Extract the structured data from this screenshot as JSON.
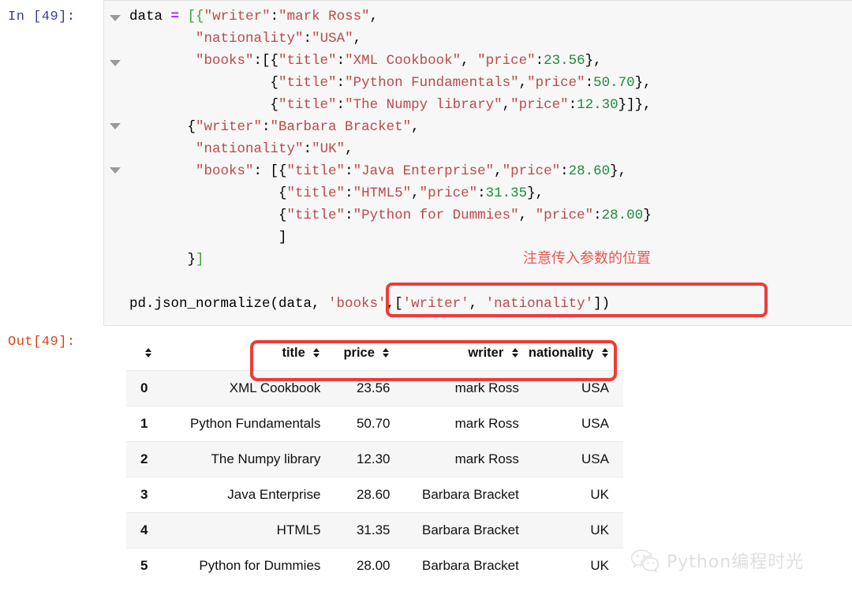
{
  "notebook": {
    "in_prompt": "In [49]:",
    "out_prompt": "Out[49]:",
    "collapse_icon": "triangle-down-icon"
  },
  "code": {
    "lines": [
      "data = [{\"writer\":\"mark Ross\",",
      "        \"nationality\":\"USA\",",
      "        \"books\":[{\"title\":\"XML Cookbook\", \"price\":23.56},",
      "                 {\"title\":\"Python Fundamentals\",\"price\":50.70},",
      "                 {\"title\":\"The Numpy library\",\"price\":12.30}]},",
      "        {\"writer\":\"Barbara Bracket\",",
      "         \"nationality\":\"UK\",",
      "         \"books\": [{\"title\":\"Java Enterprise\",\"price\":28.60},",
      "                   {\"title\":\"HTML5\",\"price\":31.35},",
      "                   {\"title\":\"Python for Dummies\", \"price\":28.00}",
      "                   ]",
      "        }]",
      "",
      "pd.json_normalize(data, 'books',['writer', 'nationality'])"
    ],
    "statement_call": "pd.json_normalize(data, 'books',['writer', 'nationality'])",
    "highlighted_arguments": "'books',['writer', 'nationality'])"
  },
  "annotation": {
    "text": "注意传入参数的位置"
  },
  "table": {
    "columns": [
      "",
      "title",
      "price",
      "writer",
      "nationality"
    ],
    "sort_icon": "sort-updown-icon",
    "rows": [
      {
        "index": "0",
        "title": "XML Cookbook",
        "price": "23.56",
        "writer": "mark Ross",
        "nationality": "USA"
      },
      {
        "index": "1",
        "title": "Python Fundamentals",
        "price": "50.70",
        "writer": "mark Ross",
        "nationality": "USA"
      },
      {
        "index": "2",
        "title": "The Numpy library",
        "price": "12.30",
        "writer": "mark Ross",
        "nationality": "USA"
      },
      {
        "index": "3",
        "title": "Java Enterprise",
        "price": "28.60",
        "writer": "Barbara Bracket",
        "nationality": "UK"
      },
      {
        "index": "4",
        "title": "HTML5",
        "price": "31.35",
        "writer": "Barbara Bracket",
        "nationality": "UK"
      },
      {
        "index": "5",
        "title": "Python for Dummies",
        "price": "28.00",
        "writer": "Barbara Bracket",
        "nationality": "UK"
      }
    ]
  },
  "watermark": {
    "text": "Python编程时光",
    "icon": "wechat-icon"
  },
  "colors": {
    "highlight_red": "#ee3b38",
    "annotation_red": "#e8574f",
    "in_prompt_blue": "#303f9f",
    "out_prompt_red": "#d84315",
    "string_red": "#bb4a4a",
    "number_green": "#1f8a3f",
    "cell_background": "#f7f7f7"
  }
}
